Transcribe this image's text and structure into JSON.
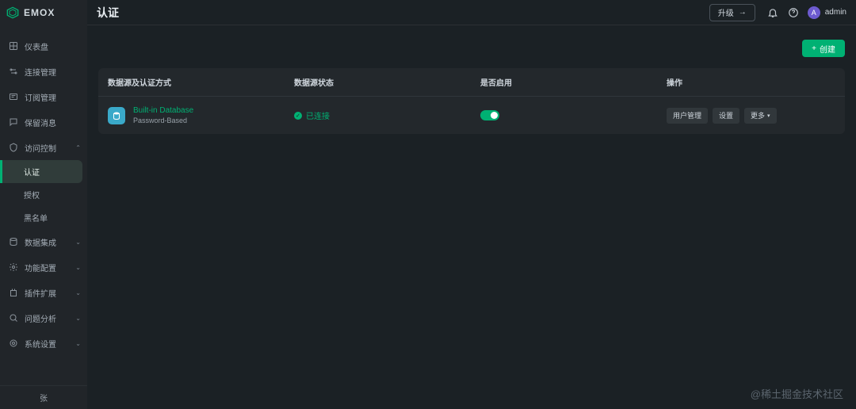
{
  "brand": "EMOX",
  "page_title": "认证",
  "topbar": {
    "upgrade": "升级",
    "user_initial": "A",
    "user_name": "admin"
  },
  "sidebar": {
    "items": [
      {
        "label": "仪表盘"
      },
      {
        "label": "连接管理"
      },
      {
        "label": "订阅管理"
      },
      {
        "label": "保留消息"
      },
      {
        "label": "访问控制",
        "expanded": true,
        "children": [
          {
            "label": "认证",
            "active": true
          },
          {
            "label": "授权"
          },
          {
            "label": "黑名单"
          }
        ]
      },
      {
        "label": "数据集成",
        "expandable": true
      },
      {
        "label": "功能配置",
        "expandable": true
      },
      {
        "label": "插件扩展",
        "expandable": true
      },
      {
        "label": "问题分析",
        "expandable": true
      },
      {
        "label": "系统设置",
        "expandable": true
      }
    ],
    "collapse_hint": "张"
  },
  "toolbar": {
    "create": "创建"
  },
  "table": {
    "headers": {
      "source": "数据源及认证方式",
      "status": "数据源状态",
      "enabled": "是否启用",
      "actions": "操作"
    },
    "rows": [
      {
        "name": "Built-in Database",
        "subtitle": "Password-Based",
        "status_text": "已连接",
        "enabled": true,
        "actions": {
          "users": "用户管理",
          "settings": "设置",
          "more": "更多"
        }
      }
    ]
  },
  "watermark": "@稀土掘金技术社区"
}
